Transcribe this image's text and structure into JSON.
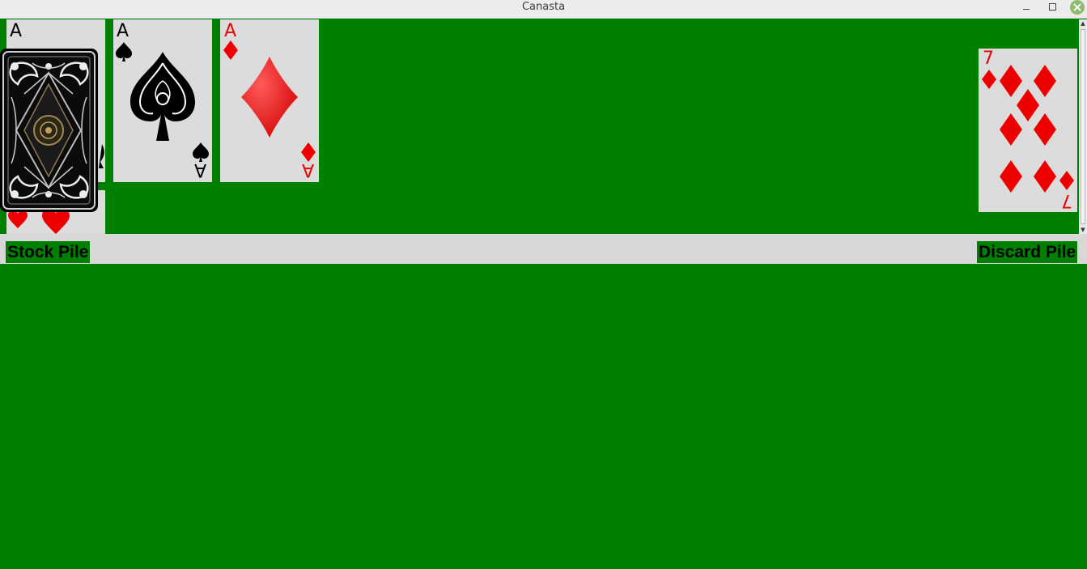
{
  "window": {
    "title": "Canasta",
    "controls": [
      "minimize-icon",
      "maximize-icon",
      "close-icon"
    ]
  },
  "colors": {
    "table_felt": "#008000",
    "card_face": "#dcdcdc",
    "label_bar": "#d8d8d8",
    "red_suit": "#e00000",
    "black_suit": "#000000"
  },
  "meld_cards": [
    {
      "rank": "A",
      "suit": "hearts",
      "note": "partially covered"
    },
    {
      "rank": "A",
      "suit": "spades"
    },
    {
      "rank": "A",
      "suit": "diamonds"
    }
  ],
  "stock_pile": {
    "label": "Stock Pile",
    "card_back": "ornate-black-card-back"
  },
  "discard_pile": {
    "label": "Discard Pile",
    "top_card": {
      "rank": "7",
      "suit": "diamonds"
    }
  }
}
